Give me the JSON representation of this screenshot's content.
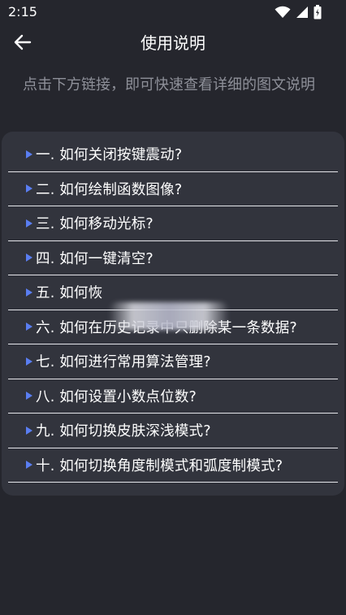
{
  "status_bar": {
    "time": "2:15",
    "icons": [
      "wifi-icon",
      "cellular-signal-icon",
      "battery-icon"
    ]
  },
  "app_bar": {
    "back_icon": "arrow-left-icon",
    "title": "使用说明"
  },
  "intro_text": "点击下方链接，即可快速查看详细的图文说明",
  "links": [
    {
      "label": "一. 如何关闭按键震动?"
    },
    {
      "label": "二. 如何绘制函数图像?"
    },
    {
      "label": "三. 如何移动光标?"
    },
    {
      "label": "四. 如何一键清空?"
    },
    {
      "label": "五. 如何恢"
    },
    {
      "label": "六. 如何在历史记录中只删除某一条数据?"
    },
    {
      "label": "七. 如何进行常用算法管理?"
    },
    {
      "label": "八. 如何设置小数点位数?"
    },
    {
      "label": "九. 如何切换皮肤深浅模式?"
    },
    {
      "label": "十. 如何切换角度制模式和弧度制模式?"
    }
  ],
  "colors": {
    "background": "#25262d",
    "card": "#32343d",
    "accent_arrow": "#5a7ef2",
    "intro_text": "#8e9099",
    "divider": "#e4e5ea"
  }
}
